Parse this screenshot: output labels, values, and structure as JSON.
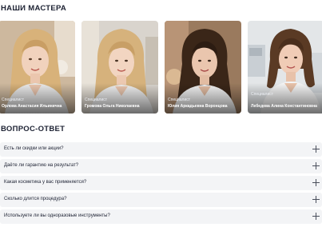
{
  "masters_section": {
    "title": "НАШИ МАСТЕРА",
    "cards": [
      {
        "role": "Специалист",
        "name": "Орлова Анастасия Ильинична",
        "hair_color": "#d8b27a",
        "bg_color": "#cbb79f"
      },
      {
        "role": "Специалист",
        "name": "Громова Ольга Николаевна",
        "hair_color": "#d6b27c",
        "bg_color": "#d9d4cd"
      },
      {
        "role": "Специалист",
        "name": "Юлия Аркадьевна Воронцова",
        "hair_color": "#3a2618",
        "bg_color": "#9a7a5e"
      },
      {
        "role": "Специалист",
        "name": "Лебедева Алина Константиновна",
        "hair_color": "#5a3a24",
        "bg_color": "#e3e6e8"
      }
    ]
  },
  "faq_section": {
    "title": "ВОПРОС-ОТВЕТ",
    "items": [
      {
        "question": "Есть ли скидки или акции?"
      },
      {
        "question": "Даёте ли гарантию на результат?"
      },
      {
        "question": "Какая косметика у вас применяется?"
      },
      {
        "question": "Сколько длится процедура?"
      },
      {
        "question": "Используете ли вы одноразовые инструменты?"
      }
    ]
  }
}
